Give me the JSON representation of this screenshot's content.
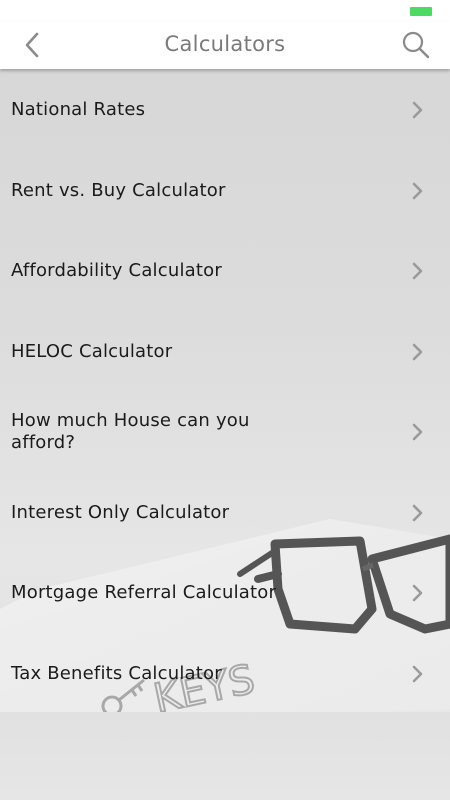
{
  "header": {
    "title": "Calculators",
    "back_icon": "chevron-left-icon",
    "search_icon": "search-icon"
  },
  "status_bar": {
    "battery_color": "#4cd964"
  },
  "menu": {
    "items": [
      {
        "label": "National Rates"
      },
      {
        "label": "Rent vs. Buy Calculator"
      },
      {
        "label": "Affordability Calculator"
      },
      {
        "label": "HELOC Calculator"
      },
      {
        "label": "How much House can you afford?"
      },
      {
        "label": "Interest Only Calculator"
      },
      {
        "label": "Mortgage Referral Calculator"
      },
      {
        "label": "Tax Benefits Calculator"
      }
    ],
    "chevron_icon": "chevron-right-icon"
  },
  "background": {
    "watermark_text": "KEYS"
  }
}
